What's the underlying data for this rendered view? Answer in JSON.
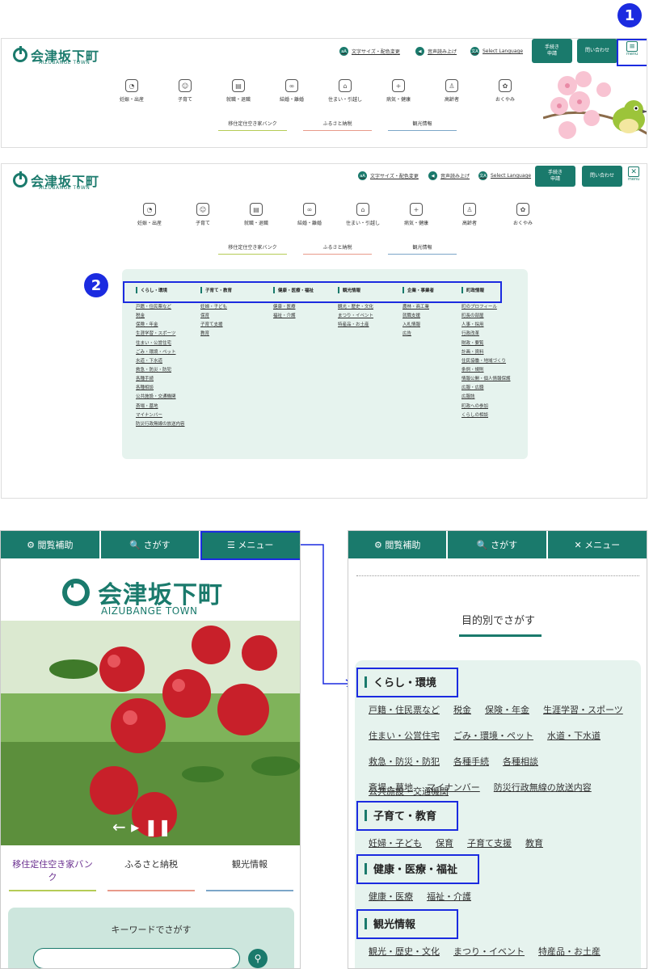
{
  "site": {
    "name": "会津坂下町",
    "sub": "AIZUBANGE TOWN"
  },
  "util": {
    "text_size": "文字サイズ・配色変更",
    "read": "音声読み上げ",
    "lang": "Select Language",
    "text_icon": "aA",
    "lang_icon": "文A"
  },
  "buttons": {
    "procedure": "手続き\n申請",
    "contact": "問い合わせ",
    "menu": "menu"
  },
  "nav": [
    {
      "icon": "pregnancy-icon",
      "label": "妊娠・出産"
    },
    {
      "icon": "child-icon",
      "label": "子育て"
    },
    {
      "icon": "briefcase-icon",
      "label": "就職・退職"
    },
    {
      "icon": "rings-icon",
      "label": "結婚・離婚"
    },
    {
      "icon": "house-icon",
      "label": "住まい・引越し"
    },
    {
      "icon": "medical-icon",
      "label": "病気・健康"
    },
    {
      "icon": "elderly-icon",
      "label": "高齢者"
    },
    {
      "icon": "flower-icon",
      "label": "おくやみ"
    }
  ],
  "sub_links": [
    "移住定住空き家バンク",
    "ふるさと納税",
    "観光情報"
  ],
  "badges": [
    "1",
    "2"
  ],
  "mega": [
    {
      "head": "くらし・環境",
      "links": [
        "戸籍・住民票など",
        "税金",
        "保険・年金",
        "生涯学習・スポーツ",
        "住まい・公営住宅",
        "ごみ・環境・ペット",
        "水道・下水道",
        "救急・防災・防犯",
        "各種手続",
        "各種相談",
        "公共施設・交通機関",
        "斎場・墓地",
        "マイナンバー",
        "防災行政無線の放送内容"
      ]
    },
    {
      "head": "子育て・教育",
      "links": [
        "妊婦・子ども",
        "保育",
        "子育て支援",
        "教育"
      ]
    },
    {
      "head": "健康・医療・福祉",
      "links": [
        "健康・医療",
        "福祉・介護"
      ]
    },
    {
      "head": "観光情報",
      "links": [
        "観光・歴史・文化",
        "まつり・イベント",
        "特産品・お土産"
      ]
    },
    {
      "head": "企業・事業者",
      "links": [
        "農林・商工業",
        "就職支援",
        "入札情報",
        "広告"
      ]
    },
    {
      "head": "町政情報",
      "links": [
        "町のプロフィール",
        "町長の部屋",
        "人事・採用",
        "行政改革",
        "財政・要覧",
        "計画・資料",
        "住民協働・地域づくり",
        "条例・規則",
        "情報公開・個人情報保護",
        "広報・広聴",
        "広報誌",
        "町政への参加",
        "くらしの相談"
      ]
    }
  ],
  "mobile_tabs": [
    "⚙ 閲覧補助",
    "🔍 さがす",
    "☰ メニュー"
  ],
  "mobile_tabs2": [
    "⚙ 閲覧補助",
    "🔍 さがす",
    "✕ メニュー"
  ],
  "mobile": {
    "keyword": "キーワードでさがす",
    "purpose": "目的別でさがす"
  }
}
